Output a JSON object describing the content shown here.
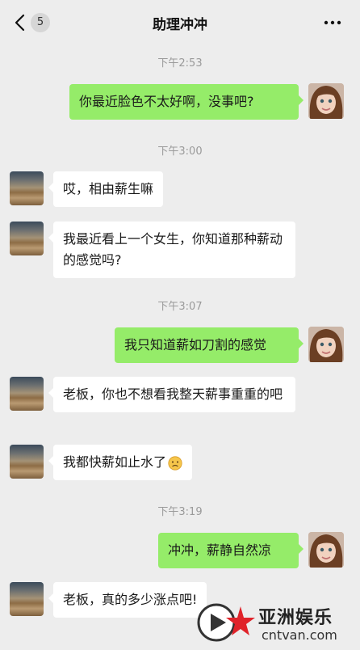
{
  "header": {
    "back_count": "5",
    "title": "助理冲冲"
  },
  "messages": [
    {
      "type": "time",
      "text": "下午2:53"
    },
    {
      "type": "msg",
      "side": "right",
      "text": "你最近脸色不太好啊，没事吧?"
    },
    {
      "type": "time",
      "text": "下午3:00"
    },
    {
      "type": "msg",
      "side": "left",
      "text": "哎，相由薪生嘛"
    },
    {
      "type": "msg",
      "side": "left",
      "text": "我最近看上一个女生，你知道那种薪动的感觉吗?"
    },
    {
      "type": "time",
      "text": "下午3:07"
    },
    {
      "type": "msg",
      "side": "right",
      "text": "我只知道薪如刀割的感觉"
    },
    {
      "type": "msg",
      "side": "left",
      "text": "老板，你也不想看我整天薪事重重的吧"
    },
    {
      "type": "msg",
      "side": "left",
      "text": "我都快薪如止水了"
    },
    {
      "type": "time",
      "text": "下午3:19"
    },
    {
      "type": "msg",
      "side": "right",
      "text": "冲冲，薪静自然凉"
    },
    {
      "type": "msg",
      "side": "left",
      "text": "老板，真的多少涨点吧!"
    }
  ],
  "watermark": {
    "cn": "亚洲娱乐",
    "en": "cntvan.com"
  },
  "icons": [
    "back-chevron-icon",
    "more-dots-icon",
    "sad-face-emoji-icon",
    "watermark-logo-icon"
  ]
}
